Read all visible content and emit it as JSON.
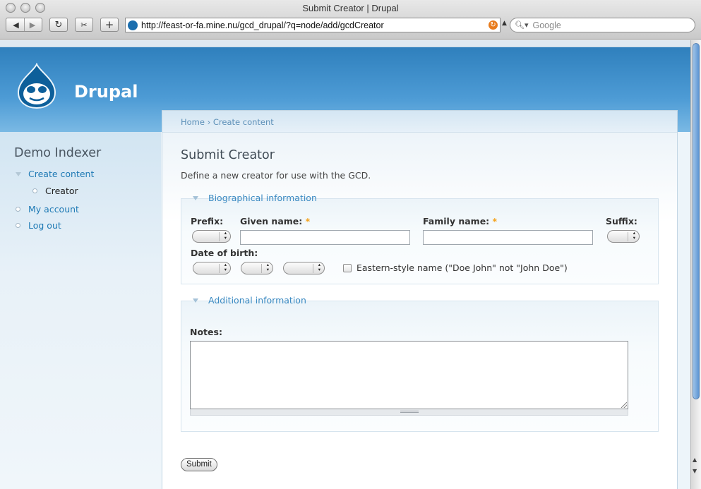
{
  "window": {
    "title": "Submit Creator | Drupal"
  },
  "toolbar": {
    "url": "http://feast-or-fa.mine.nu/gcd_drupal/?q=node/add/gcdCreator",
    "search_placeholder": "Google",
    "back_icon": "back-arrow-icon",
    "forward_icon": "forward-arrow-icon",
    "reload_icon": "reload-icon",
    "add_icon": "plus-icon"
  },
  "site": {
    "name": "Drupal",
    "brand_color": "#2f80bd"
  },
  "sidebar": {
    "title": "Demo Indexer",
    "items": [
      {
        "label": "Create content",
        "link": true
      },
      {
        "label": "Creator",
        "link": false
      },
      {
        "label": "My account",
        "link": true
      },
      {
        "label": "Log out",
        "link": true
      }
    ]
  },
  "breadcrumb": {
    "items": [
      "Home",
      "Create content"
    ],
    "separator": "›"
  },
  "page": {
    "title": "Submit Creator",
    "description": "Define a new creator for use with the GCD."
  },
  "form": {
    "bio_legend": "Biographical information",
    "prefix_label": "Prefix:",
    "given_label": "Given name:",
    "family_label": "Family name:",
    "suffix_label": "Suffix:",
    "required_mark": "*",
    "dob_label": "Date of birth:",
    "eastern_label": "Eastern-style name (\"Doe John\" not \"John Doe\")",
    "additional_legend": "Additional information",
    "notes_label": "Notes:",
    "submit_label": "Submit",
    "given_value": "",
    "family_value": "",
    "notes_value": "",
    "eastern_checked": false
  }
}
